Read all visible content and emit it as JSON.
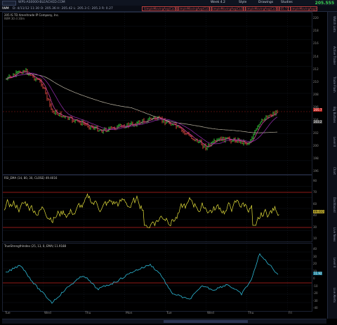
{
  "topbar": {
    "window_title": "WPS-AS0000-BLEACHED.COM",
    "menu_items": [
      "Week 4.2",
      "Style",
      "Drawings",
      "Studies"
    ],
    "last_price": "205.555"
  },
  "toolbar": {
    "symbol": "IWM",
    "quote_line": "D: 4/11/12 11:30  O: 205.36  H: 205.42  L: 205.3  C: 205.3  R: 0.27",
    "study_labels": [
      "SimpleMovingAvg(CLOSE, 50, 0)",
      "SimpleMovingAvg(CLOSE, 200, 0)",
      "SimpleMovingAvg(CLOSE, 200, 0)",
      "SimpleMovingAvg(CLOSE, 20, 0)",
      "205.73",
      "SimpleMovingAvg(CLOSE, 20, 0)"
    ]
  },
  "price_pane": {
    "header": "205 IS TD Ameritrade IP Company, Inc.",
    "subheader": "IWM  30 d  30m",
    "price_tag": "205.7",
    "price_tag2": "203.2",
    "y_labels": [
      "220",
      "218",
      "216",
      "214",
      "212",
      "210",
      "208",
      "206",
      "204",
      "202",
      "200",
      "198",
      "196"
    ]
  },
  "rsi_pane": {
    "header": "RSI_EMA (14, 80, 30, CLOSE)  49.4016",
    "value_tag": "49.432",
    "y_labels": [
      "90",
      "70",
      "60",
      "40",
      "30",
      "10"
    ]
  },
  "tsi_pane": {
    "header": "TrueStrengthIndex (25, 13, 8, EMA)  11.9188",
    "value_tag": "11.92",
    "y_labels": [
      "40",
      "30",
      "20",
      "10",
      "0",
      "-10",
      "-20",
      "-30",
      "-40"
    ]
  },
  "x_axis": {
    "labels": [
      "Tue",
      "Wed",
      "Thu",
      "Mon",
      "Tue",
      "Wed",
      "Thu",
      "Fri"
    ]
  },
  "side_tabs": [
    "Watch Lists",
    "Active Trader",
    "Trade Flash",
    "Big Buttons",
    "Level II",
    "Chart",
    "Dashboard",
    "Live News",
    "Level II",
    "Live Alerts"
  ],
  "colors": {
    "price_up": "#39c43a",
    "price_down": "#d4453c",
    "ma_fast": "#d03f9e",
    "ma_mid": "#8a2aa0",
    "ma_slow": "#bdb6a4",
    "rsi_line": "#e6e23c",
    "tsi_line": "#2db9d6",
    "ref_line": "#c0231f"
  }
}
